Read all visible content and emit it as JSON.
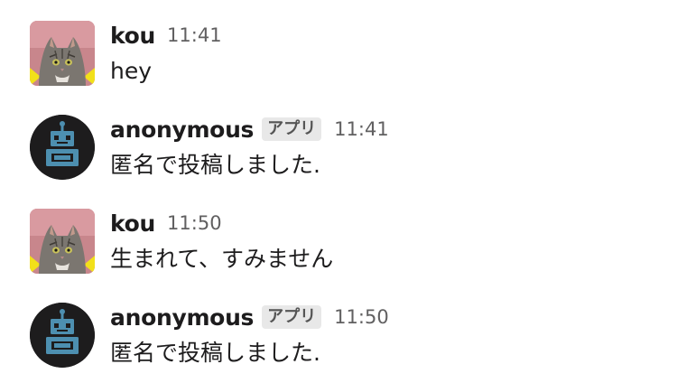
{
  "messages": [
    {
      "author": "kou",
      "avatar": "cat-avatar-icon",
      "is_app": false,
      "badge": "",
      "time": "11:41",
      "text": "hey"
    },
    {
      "author": "anonymous",
      "avatar": "robot-avatar-icon",
      "is_app": true,
      "badge": "アプリ",
      "time": "11:41",
      "text": "匿名で投稿しました."
    },
    {
      "author": "kou",
      "avatar": "cat-avatar-icon",
      "is_app": false,
      "badge": "",
      "time": "11:50",
      "text": "生まれて、すみません"
    },
    {
      "author": "anonymous",
      "avatar": "robot-avatar-icon",
      "is_app": true,
      "badge": "アプリ",
      "time": "11:50",
      "text": "匿名で投稿しました."
    }
  ],
  "colors": {
    "text": "#1d1c1d",
    "timestamp": "#616061",
    "badge_bg": "#e8e8e8",
    "robot": "#4d8fb0",
    "robot_bg": "#1d1c1d"
  }
}
